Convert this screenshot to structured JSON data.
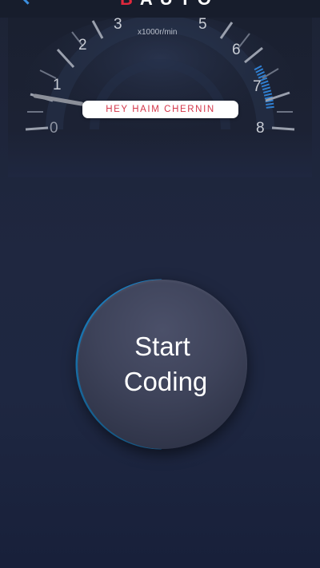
{
  "header": {
    "brand_first": "B",
    "brand_rest": "AUTO",
    "back_icon": "chevron-left-icon",
    "accent_color": "#3b8fe0",
    "brand_color": "#e0283c"
  },
  "tachometer": {
    "unit_label": "x1000r/min",
    "scale": [
      "0",
      "1",
      "2",
      "3",
      "5",
      "6",
      "7",
      "8"
    ],
    "redline_color": "#2f7fd1"
  },
  "greeting": {
    "text": "HEY HAIM CHERNIN",
    "text_color": "#d43549"
  },
  "start": {
    "line1": "Start",
    "line2": "Coding",
    "ring_color": "#1f8ed6"
  }
}
